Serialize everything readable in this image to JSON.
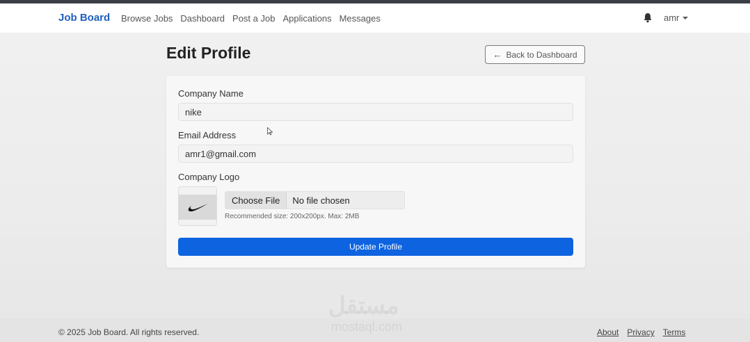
{
  "navbar": {
    "brand": "Job Board",
    "links": [
      "Browse Jobs",
      "Dashboard",
      "Post a Job",
      "Applications",
      "Messages"
    ],
    "username": "amr",
    "icons": {
      "notifications": "bell-icon",
      "user_menu": "caret-down-icon"
    }
  },
  "page": {
    "title": "Edit Profile",
    "back_label": "Back to Dashboard",
    "back_icon": "arrow-left-icon"
  },
  "form": {
    "company_name_label": "Company Name",
    "company_name_value": "nike",
    "email_label": "Email Address",
    "email_value": "amr1@gmail.com",
    "logo_label": "Company Logo",
    "choose_file_label": "Choose File",
    "file_status": "No file chosen",
    "hint": "Recommended size: 200x200px. Max: 2MB",
    "submit_label": "Update Profile"
  },
  "footer": {
    "copyright": "© 2025 Job Board. All rights reserved.",
    "links": [
      "About",
      "Privacy",
      "Terms"
    ]
  },
  "watermark": {
    "main": "مستقل",
    "sub": "mostaql.com"
  },
  "colors": {
    "brand": "#1f5fbf",
    "primary_button": "#0d63e0"
  }
}
